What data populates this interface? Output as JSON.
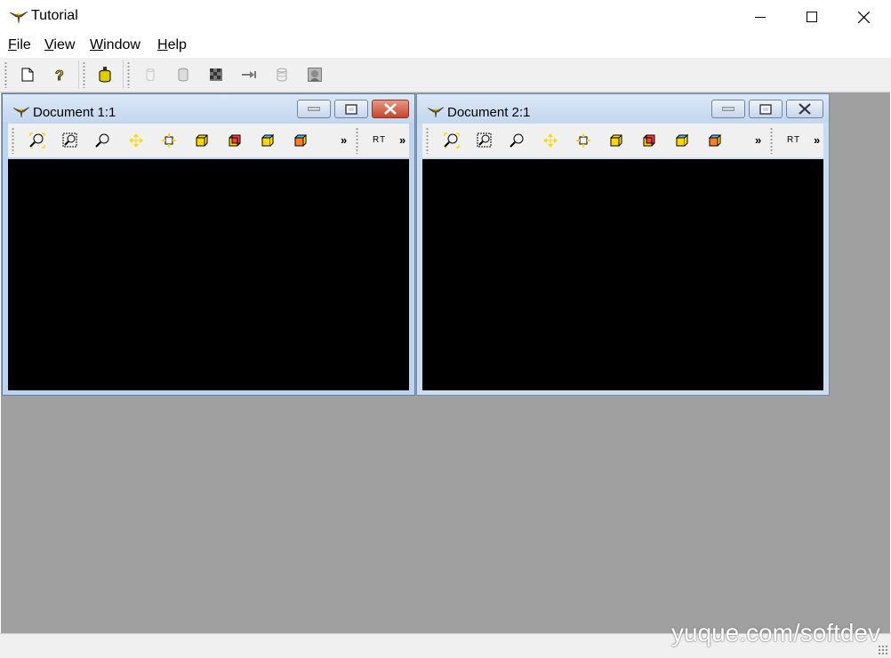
{
  "window": {
    "title": "Tutorial"
  },
  "menu": [
    {
      "label": "File",
      "accel": "F",
      "rest": "ile"
    },
    {
      "label": "View",
      "accel": "V",
      "rest": "iew"
    },
    {
      "label": "Window",
      "accel": "W",
      "rest": "indow"
    },
    {
      "label": "Help",
      "accel": "H",
      "rest": "elp"
    }
  ],
  "toolbar": {
    "icons": [
      "new-document-icon",
      "help-icon",
      "database-icon",
      "shape-icon",
      "cylinder-icon",
      "texture-icon",
      "arrow-icon",
      "cylinder-outline-icon",
      "image-icon"
    ]
  },
  "documents": [
    {
      "title": "Document 1:1",
      "active": true,
      "rt_label": "RT",
      "more": "»"
    },
    {
      "title": "Document 2:1",
      "active": false,
      "rt_label": "RT",
      "more": "»"
    }
  ],
  "doc_toolbar_icons": [
    "fit-all-icon",
    "zoom-window-icon",
    "zoom-icon",
    "pan-icon",
    "global-pan-icon",
    "front-view-icon",
    "back-view-icon",
    "top-view-icon",
    "axonometric-view-icon"
  ],
  "watermark": "yuque.com/softdev",
  "colors": {
    "accent": "#c6452e",
    "mdi_background": "#a0a0a0",
    "viewport": "#000000",
    "icon_yellow": "#ffd800"
  }
}
